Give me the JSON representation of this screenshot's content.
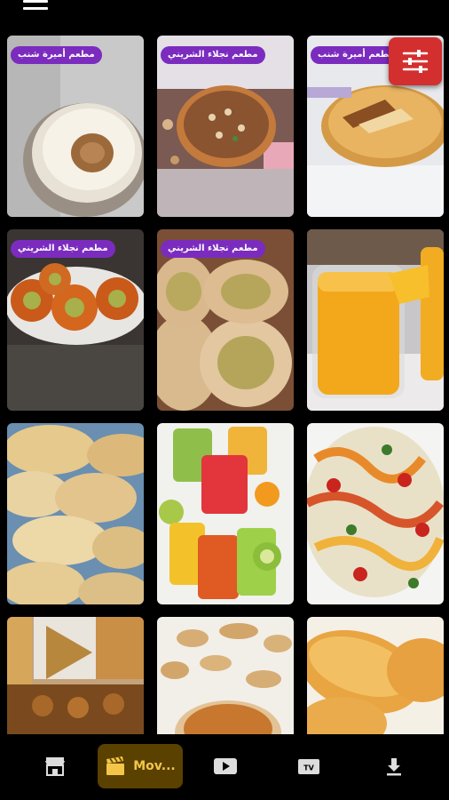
{
  "header": {
    "menu_icon": "hamburger-menu-icon"
  },
  "filter_button": {
    "icon": "sliders-icon",
    "color": "#d32f2f"
  },
  "tiles": [
    {
      "badge": "مطعم أميرة شنب",
      "image": "rice-pudding-bowl"
    },
    {
      "badge": "مطعم نجلاء الشريني",
      "image": "nut-pie"
    },
    {
      "badge": "مطعم أميرة شنب",
      "image": "basbousa-cake"
    },
    {
      "badge": "مطعم نجلاء الشريني",
      "image": "konafa-rings"
    },
    {
      "badge": "مطعم نجلاء الشريني",
      "image": "qatayef"
    },
    {
      "badge": "",
      "image": "orange-juice"
    },
    {
      "badge": "",
      "image": "pastry-rolls"
    },
    {
      "badge": "",
      "image": "fruit-juices"
    },
    {
      "badge": "",
      "image": "pasta-salad"
    },
    {
      "badge": "",
      "image": "oriental-sweets"
    },
    {
      "badge": "",
      "image": "peanut-butter"
    },
    {
      "badge": "",
      "image": "bread-loaves"
    }
  ],
  "bottom_nav": {
    "items": [
      {
        "icon": "store-icon",
        "label": ""
      },
      {
        "icon": "clapperboard-icon",
        "label": "Mov...",
        "active": true
      },
      {
        "icon": "youtube-play-icon",
        "label": ""
      },
      {
        "icon": "tv-icon",
        "label": ""
      },
      {
        "icon": "download-icon",
        "label": ""
      }
    ],
    "active_bg": "#5a4100",
    "active_color": "#f3c64a"
  }
}
